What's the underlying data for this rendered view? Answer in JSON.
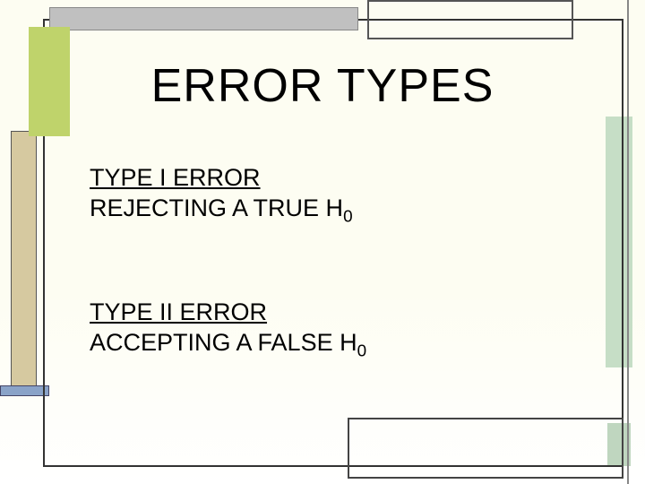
{
  "slide": {
    "title": "ERROR TYPES",
    "section1": {
      "heading": "TYPE I ERROR",
      "line_prefix": "REJECTING A TRUE H",
      "line_sub": "0"
    },
    "section2": {
      "heading": "TYPE II ERROR",
      "line_prefix": "ACCEPTING A FALSE H",
      "line_sub": "0"
    }
  }
}
